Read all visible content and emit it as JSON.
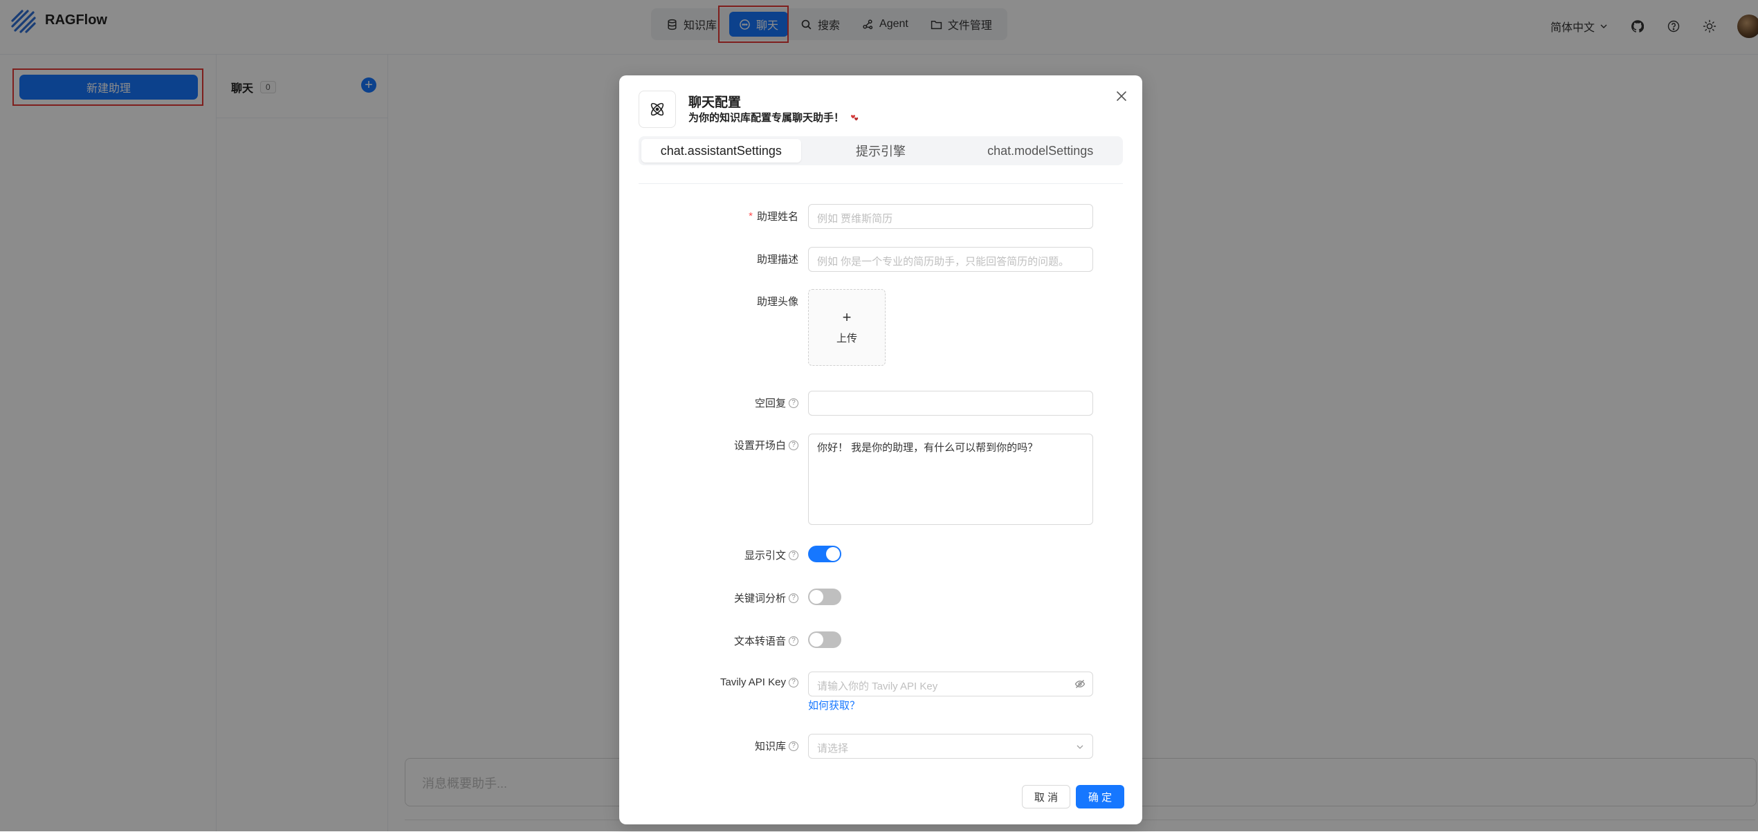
{
  "header": {
    "brand": "RAGFlow",
    "nav": [
      {
        "label": "知识库",
        "icon": "database-icon"
      },
      {
        "label": "聊天",
        "icon": "chat-bubble-icon",
        "active": true
      },
      {
        "label": "搜索",
        "icon": "search-icon"
      },
      {
        "label": "Agent",
        "icon": "agent-graph-icon"
      },
      {
        "label": "文件管理",
        "icon": "folder-icon"
      }
    ],
    "language": "简体中文",
    "icons": [
      "github-icon",
      "help-icon",
      "theme-sun-icon",
      "user-avatar"
    ]
  },
  "sidebar": {
    "new_assistant_label": "新建助理"
  },
  "chat_list": {
    "title": "聊天",
    "count": "0"
  },
  "message_input": {
    "placeholder": "消息概要助手..."
  },
  "modal": {
    "title": "聊天配置",
    "subtitle": "为你的知识库配置专属聊天助手！",
    "tabs": [
      {
        "label": "chat.assistantSettings",
        "active": true
      },
      {
        "label": "提示引擎"
      },
      {
        "label": "chat.modelSettings"
      }
    ],
    "fields": {
      "assistant_name": {
        "label": "助理姓名",
        "required": true,
        "placeholder": "例如 贾维斯简历"
      },
      "assistant_desc": {
        "label": "助理描述",
        "placeholder": "例如 你是一个专业的简历助手，只能回答简历的问题。"
      },
      "avatar": {
        "label": "助理头像",
        "upload_text": "上传",
        "plus": "+"
      },
      "empty_response": {
        "label": "空回复",
        "value": ""
      },
      "opener": {
        "label": "设置开场白",
        "value": "你好！ 我是你的助理，有什么可以帮到你的吗？"
      },
      "show_quote": {
        "label": "显示引文",
        "on": true
      },
      "keyword_analysis": {
        "label": "关键词分析",
        "on": false
      },
      "tts": {
        "label": "文本转语音",
        "on": false
      },
      "tavily": {
        "label": "Tavily API Key",
        "placeholder": "请输入你的 Tavily API Key",
        "help_link": "如何获取？"
      },
      "knowledge_base": {
        "label": "知识库",
        "placeholder": "请选择"
      }
    },
    "buttons": {
      "cancel": "取 消",
      "ok": "确 定"
    }
  },
  "colors": {
    "primary": "#1677ff",
    "required": "#ff4d4f",
    "highlight_frame": "#e53935"
  }
}
